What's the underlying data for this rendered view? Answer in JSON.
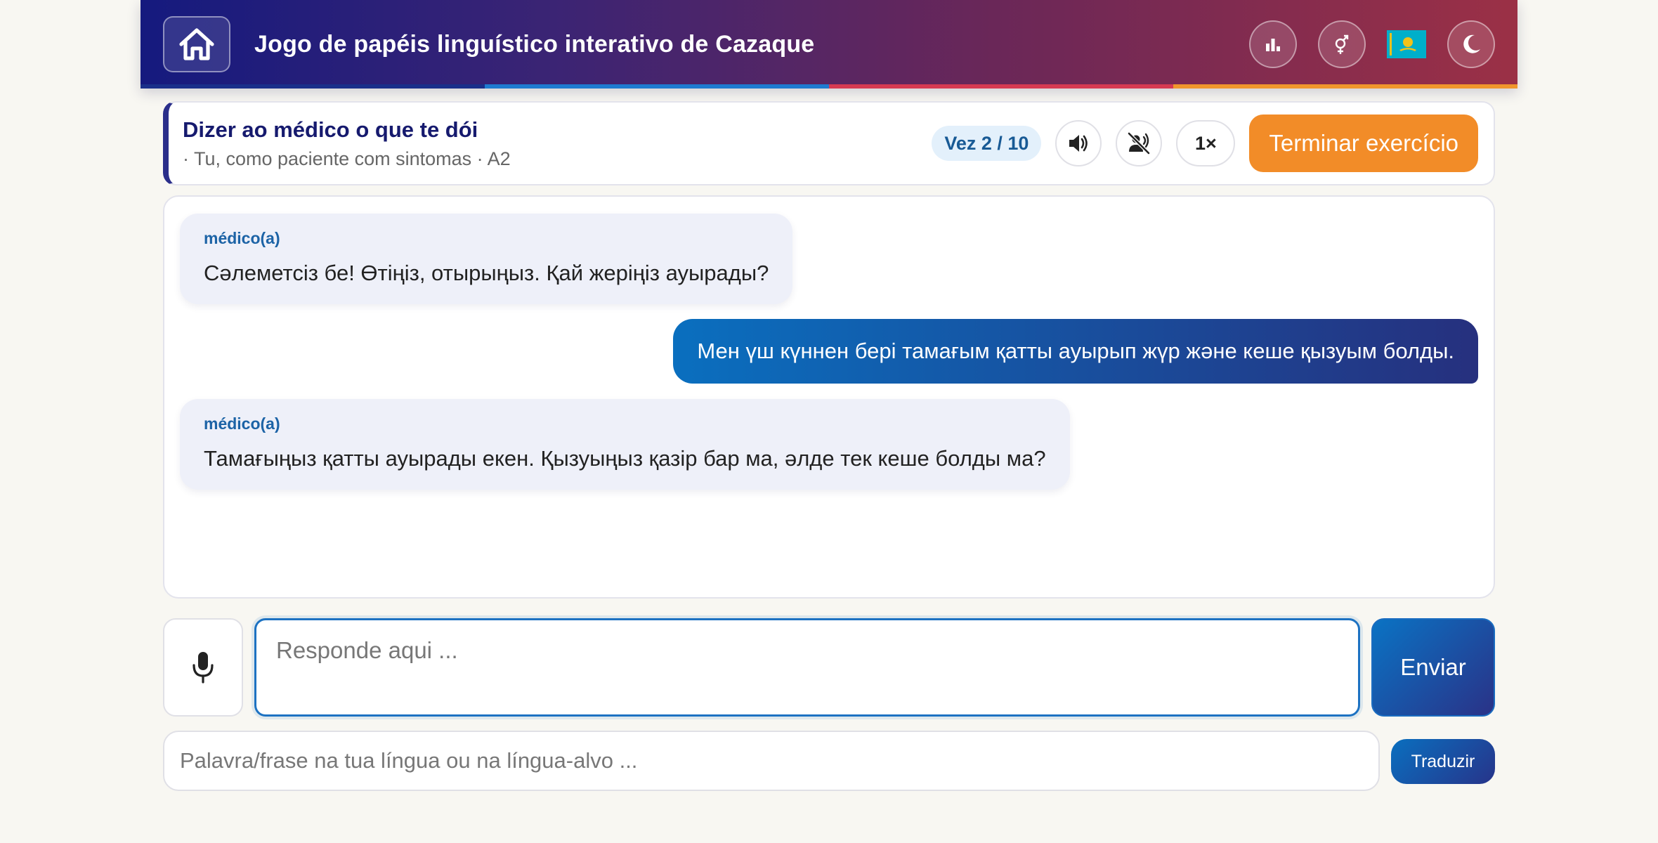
{
  "header": {
    "title": "Jogo de papéis linguístico interativo de Cazaque",
    "stripe_colors": [
      "#1a2f8a",
      "#1e7bd0",
      "#d63a52",
      "#f0962c"
    ],
    "icons": [
      "home-icon",
      "stats-icon",
      "gender-icon",
      "kazakhstan-flag-icon",
      "dark-mode-icon"
    ]
  },
  "scenario": {
    "title": "Dizer ao médico o que te dói",
    "subtitle": "· Tu, como paciente com sintomas · A2",
    "turn": "Vez 2 / 10",
    "speed": "1×",
    "end_label": "Terminar exercício",
    "tool_icons": [
      "speaker-icon",
      "voice-off-icon"
    ]
  },
  "messages": [
    {
      "role": "partner",
      "speaker": "médico(a)",
      "text": "Сәлеметсіз бе! Өтіңіз, отырыңыз. Қай жеріңіз ауырады?"
    },
    {
      "role": "user",
      "text": "Мен үш күннен бері тамағым қатты ауырып жүр және кеше қызуым болды."
    },
    {
      "role": "partner",
      "speaker": "médico(a)",
      "text": "Тамағыңыз қатты ауырады екен. Қызуыңыз қазір бар ма, әлде тек кеше болды ма?"
    }
  ],
  "input": {
    "reply_placeholder": "Responde aqui ...",
    "send_label": "Enviar",
    "translate_placeholder": "Palavra/frase na tua língua ou na língua-alvo ...",
    "translate_label": "Traduzir",
    "mic_icon": "microphone-icon"
  },
  "colors": {
    "accent": "#1d72c2",
    "end_button": "#f28c28",
    "partner_bubble": "#eef0f9"
  }
}
